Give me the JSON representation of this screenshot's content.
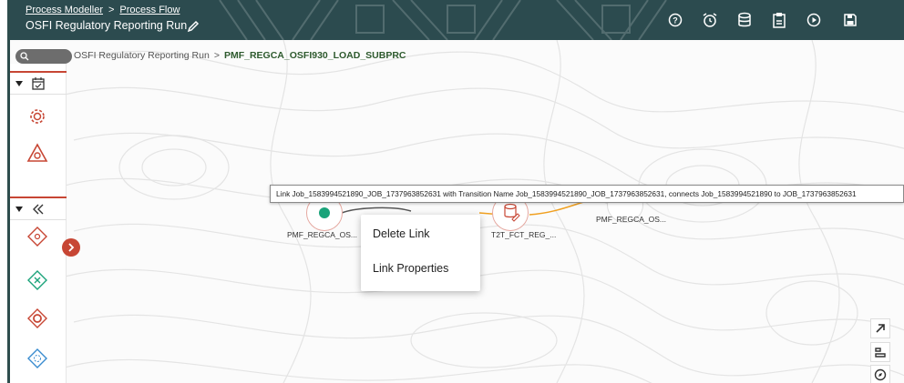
{
  "header": {
    "breadcrumb": [
      "Process Modeller",
      "Process Flow"
    ],
    "breadcrumb_sep": ">",
    "title": "OSFI Regulatory Reporting Run",
    "icons": [
      "help-icon",
      "alarm-icon",
      "database-icon",
      "clipboard-icon",
      "play-icon",
      "save-icon"
    ]
  },
  "path": {
    "parent": "OSFI Regulatory Reporting Run",
    "sep": ">",
    "current": "PMF_REGCA_OSFI930_LOAD_SUBPRC"
  },
  "nodes": [
    {
      "label": "PMF_REGCA_OS..."
    },
    {
      "label": "T2T_FCT_REG_..."
    },
    {
      "label": "PMF_REGCA_OS..."
    }
  ],
  "tooltip": "Link Job_1583994521890_JOB_1737963852631 with Transition Name Job_1583994521890_JOB_1737963852631, connects Job_1583994521890 to JOB_1737963852631",
  "context_menu": {
    "delete": "Delete Link",
    "properties": "Link Properties"
  },
  "colors": {
    "header_bg": "#2c4b4f",
    "accent_red": "#c74634",
    "link_orange": "#f0a020",
    "start_green": "#1aa37a"
  }
}
